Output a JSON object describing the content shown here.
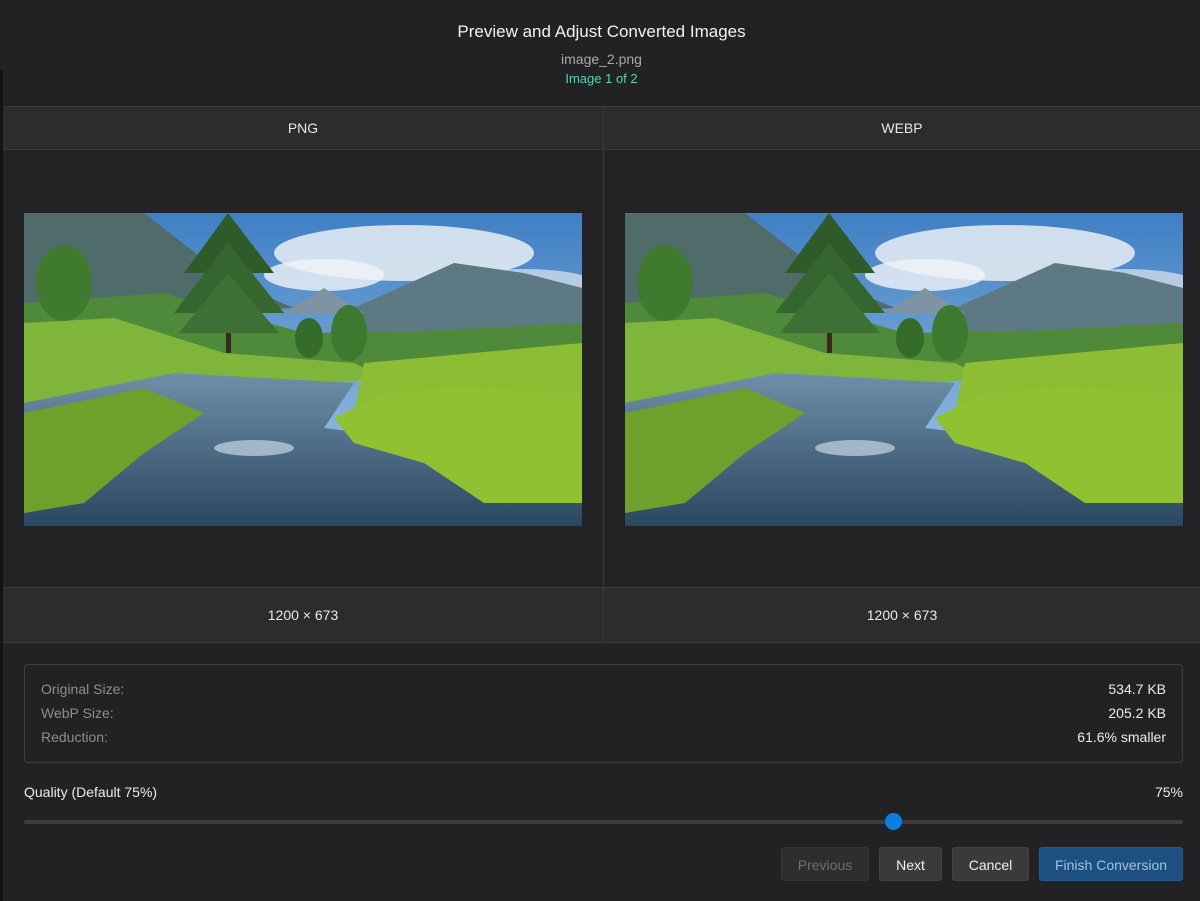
{
  "header": {
    "title": "Preview and Adjust Converted Images",
    "filename": "image_2.png",
    "counter": "Image 1 of 2"
  },
  "panes": [
    {
      "format": "PNG",
      "dimensions": "1200 × 673"
    },
    {
      "format": "WEBP",
      "dimensions": "1200 × 673"
    }
  ],
  "stats": {
    "original_label": "Original Size:",
    "original_value": "534.7 KB",
    "webp_label": "WebP Size:",
    "webp_value": "205.2 KB",
    "reduction_label": "Reduction:",
    "reduction_value": "61.6% smaller"
  },
  "quality": {
    "label": "Quality (Default 75%)",
    "value_text": "75%",
    "value": 75,
    "min": 0,
    "max": 100
  },
  "buttons": {
    "previous": "Previous",
    "next": "Next",
    "cancel": "Cancel",
    "finish": "Finish Conversion"
  },
  "colors": {
    "accent": "#0a7fe0",
    "counter": "#56d4ba",
    "primary_button": "#1d4f80"
  }
}
